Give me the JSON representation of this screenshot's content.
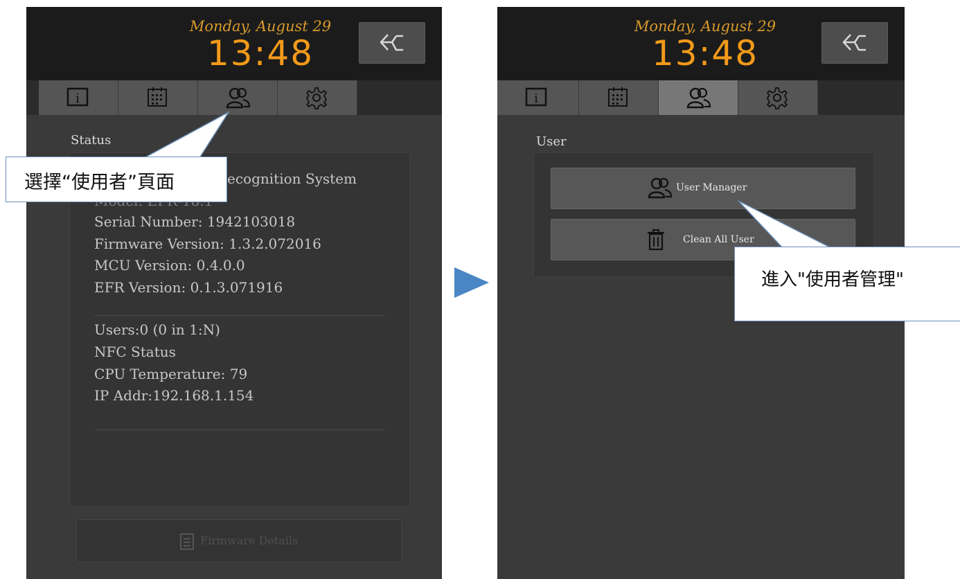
{
  "left_screen": {
    "date": "Monday, August 29",
    "time": "13:48",
    "section_title": "Status",
    "system_name": "ecognition System",
    "model_line": "Model: EFR-18.1",
    "serial": "Serial Number: 1942103018",
    "firmware": "Firmware Version: 1.3.2.072016",
    "mcu": "MCU Version: 0.4.0.0",
    "efr": "EFR Version: 0.1.3.071916",
    "users": "Users:0 (0 in 1:N)",
    "nfc": "NFC Status",
    "cpu": "CPU Temperature: 79",
    "ip": "IP Addr:192.168.1.154",
    "firmware_button": "Firmware Details"
  },
  "right_screen": {
    "date": "Monday, August 29",
    "time": "13:48",
    "section_title": "User",
    "user_manager_button": "User Manager",
    "clean_all_button": "Clean All User"
  },
  "tabs": [
    {
      "icon": "info-icon"
    },
    {
      "icon": "calendar-icon"
    },
    {
      "icon": "users-icon"
    },
    {
      "icon": "gear-icon"
    }
  ],
  "annotations": {
    "left": "選擇“使用者”頁面",
    "right": "進入\"使用者管理\""
  },
  "colors": {
    "time": "#f39a1a",
    "date": "#d89a2c",
    "panel_bg": "#3a3a3a",
    "header_bg": "#1b1b1b",
    "arrow": "#4a86c5"
  }
}
